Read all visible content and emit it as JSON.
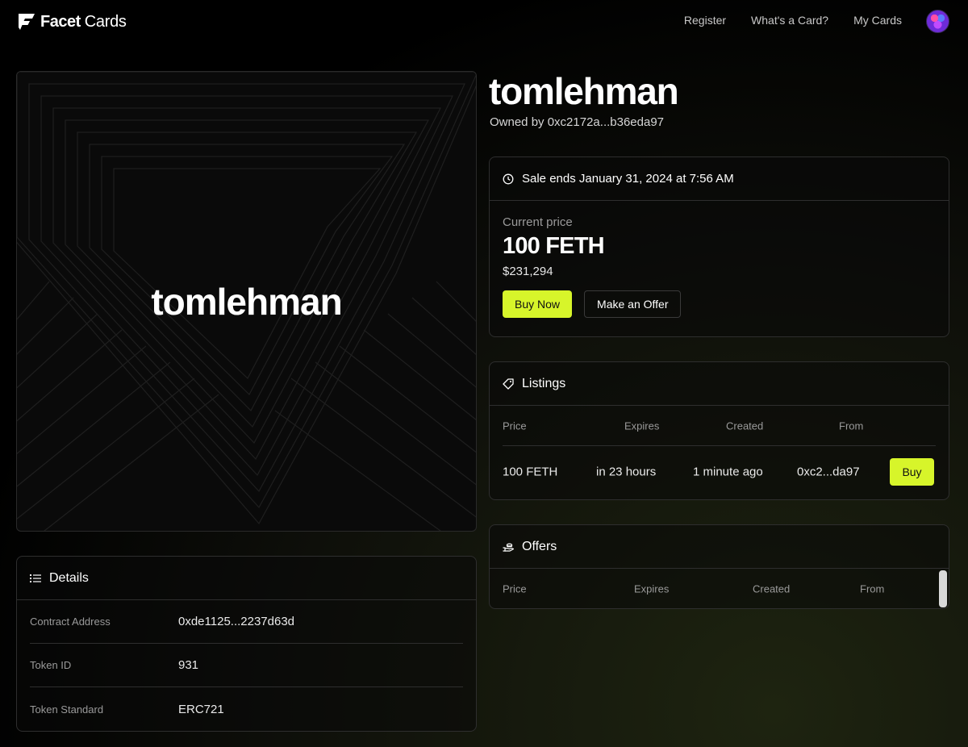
{
  "header": {
    "brand_bold": "Facet",
    "brand_light": "Cards",
    "nav": [
      "Register",
      "What's a Card?",
      "My Cards"
    ]
  },
  "card": {
    "name": "tomlehman",
    "owner_prefix": "Owned by",
    "owner": "0xc2172a...b36eda97"
  },
  "sale": {
    "ends_label": "Sale ends January 31, 2024 at 7:56 AM",
    "current_price_label": "Current price",
    "price": "100 FETH",
    "usd": "$231,294",
    "buy_now_label": "Buy Now",
    "offer_label": "Make an Offer"
  },
  "listings": {
    "title": "Listings",
    "columns": [
      "Price",
      "Expires",
      "Created",
      "From"
    ],
    "rows": [
      {
        "price": "100 FETH",
        "expires": "in 23 hours",
        "created": "1 minute ago",
        "from": "0xc2...da97",
        "action": "Buy"
      }
    ]
  },
  "offers": {
    "title": "Offers",
    "columns": [
      "Price",
      "Expires",
      "Created",
      "From"
    ]
  },
  "details": {
    "title": "Details",
    "rows": [
      {
        "label": "Contract Address",
        "value": "0xde1125...2237d63d"
      },
      {
        "label": "Token ID",
        "value": "931"
      },
      {
        "label": "Token Standard",
        "value": "ERC721"
      }
    ]
  },
  "colors": {
    "accent": "#d7f52a",
    "background": "#000000",
    "border": "#2e2e2e"
  }
}
